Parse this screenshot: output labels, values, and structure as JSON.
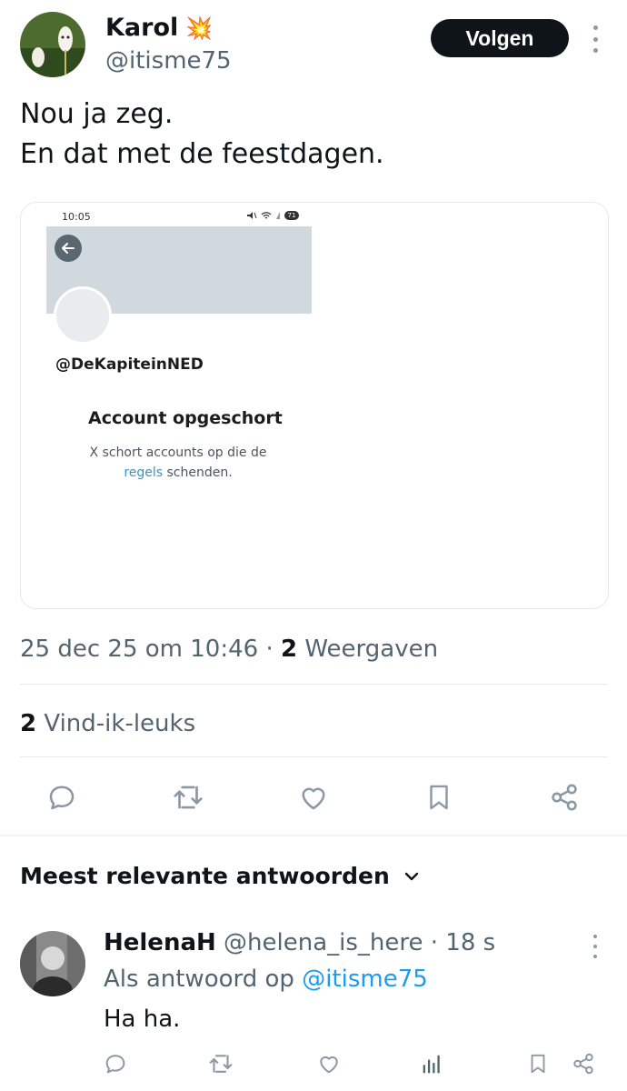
{
  "author": {
    "display_name": "Karol",
    "name_emoji": "💥",
    "handle": "@itisme75",
    "follow_label": "Volgen"
  },
  "tweet": {
    "lines": [
      "Nou ja zeg.",
      "En dat met de feestdagen."
    ]
  },
  "media": {
    "phone_time": "10:05",
    "battery": "71",
    "profile_handle": "@DeKapiteinNED",
    "title": "Account opgeschort",
    "desc_line1": "X schort accounts op die de",
    "desc_link": "regels",
    "desc_rest": " schenden."
  },
  "meta": {
    "timestamp": "25 dec 25 om 10:46",
    "separator": " · ",
    "views_count": "2",
    "views_label": " Weergaven",
    "likes_count": "2",
    "likes_label": " Vind-ik-leuks"
  },
  "actions": [
    "reply-icon",
    "retweet-icon",
    "like-icon",
    "bookmark-icon",
    "share-icon"
  ],
  "replies": {
    "header": "Meest relevante antwoorden",
    "items": [
      {
        "name": "HelenaH",
        "handle": "@helena_is_here",
        "time": " · 18 s",
        "reply_prefix": "Als antwoord op ",
        "reply_mention": "@itisme75",
        "text": "Ha ha."
      }
    ]
  },
  "colors": {
    "text": "#0f1419",
    "secondary": "#536471",
    "link": "#1d9bf0",
    "icon": "#8b98a5"
  }
}
